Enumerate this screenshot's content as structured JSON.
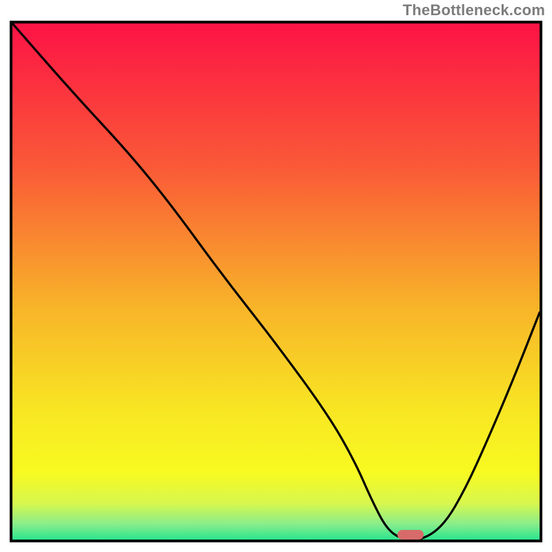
{
  "watermark": {
    "text": "TheBottleneck.com"
  },
  "chart_data": {
    "type": "line",
    "title": "",
    "xlabel": "",
    "ylabel": "",
    "xlim": [
      0,
      100
    ],
    "ylim": [
      0,
      100
    ],
    "x": [
      0,
      12,
      22,
      30,
      40,
      50,
      60,
      65,
      68,
      71,
      74,
      78,
      82,
      86,
      90,
      95,
      100
    ],
    "values": [
      100,
      86,
      75,
      65,
      51,
      38,
      24,
      15,
      8,
      2,
      0,
      0,
      3,
      10,
      19,
      31,
      44
    ],
    "marker": {
      "x_start": 73,
      "x_end": 78,
      "y": 0,
      "color": "#d66b6a"
    },
    "background_gradient_stops": [
      {
        "pos": 0.0,
        "color": "#fd1345"
      },
      {
        "pos": 0.28,
        "color": "#fa5a37"
      },
      {
        "pos": 0.55,
        "color": "#f8b429"
      },
      {
        "pos": 0.75,
        "color": "#f8e623"
      },
      {
        "pos": 0.87,
        "color": "#f8fa21"
      },
      {
        "pos": 0.93,
        "color": "#d7f74e"
      },
      {
        "pos": 0.97,
        "color": "#89ed8b"
      },
      {
        "pos": 1.0,
        "color": "#2be58e"
      }
    ],
    "grid": false,
    "legend": false
  }
}
